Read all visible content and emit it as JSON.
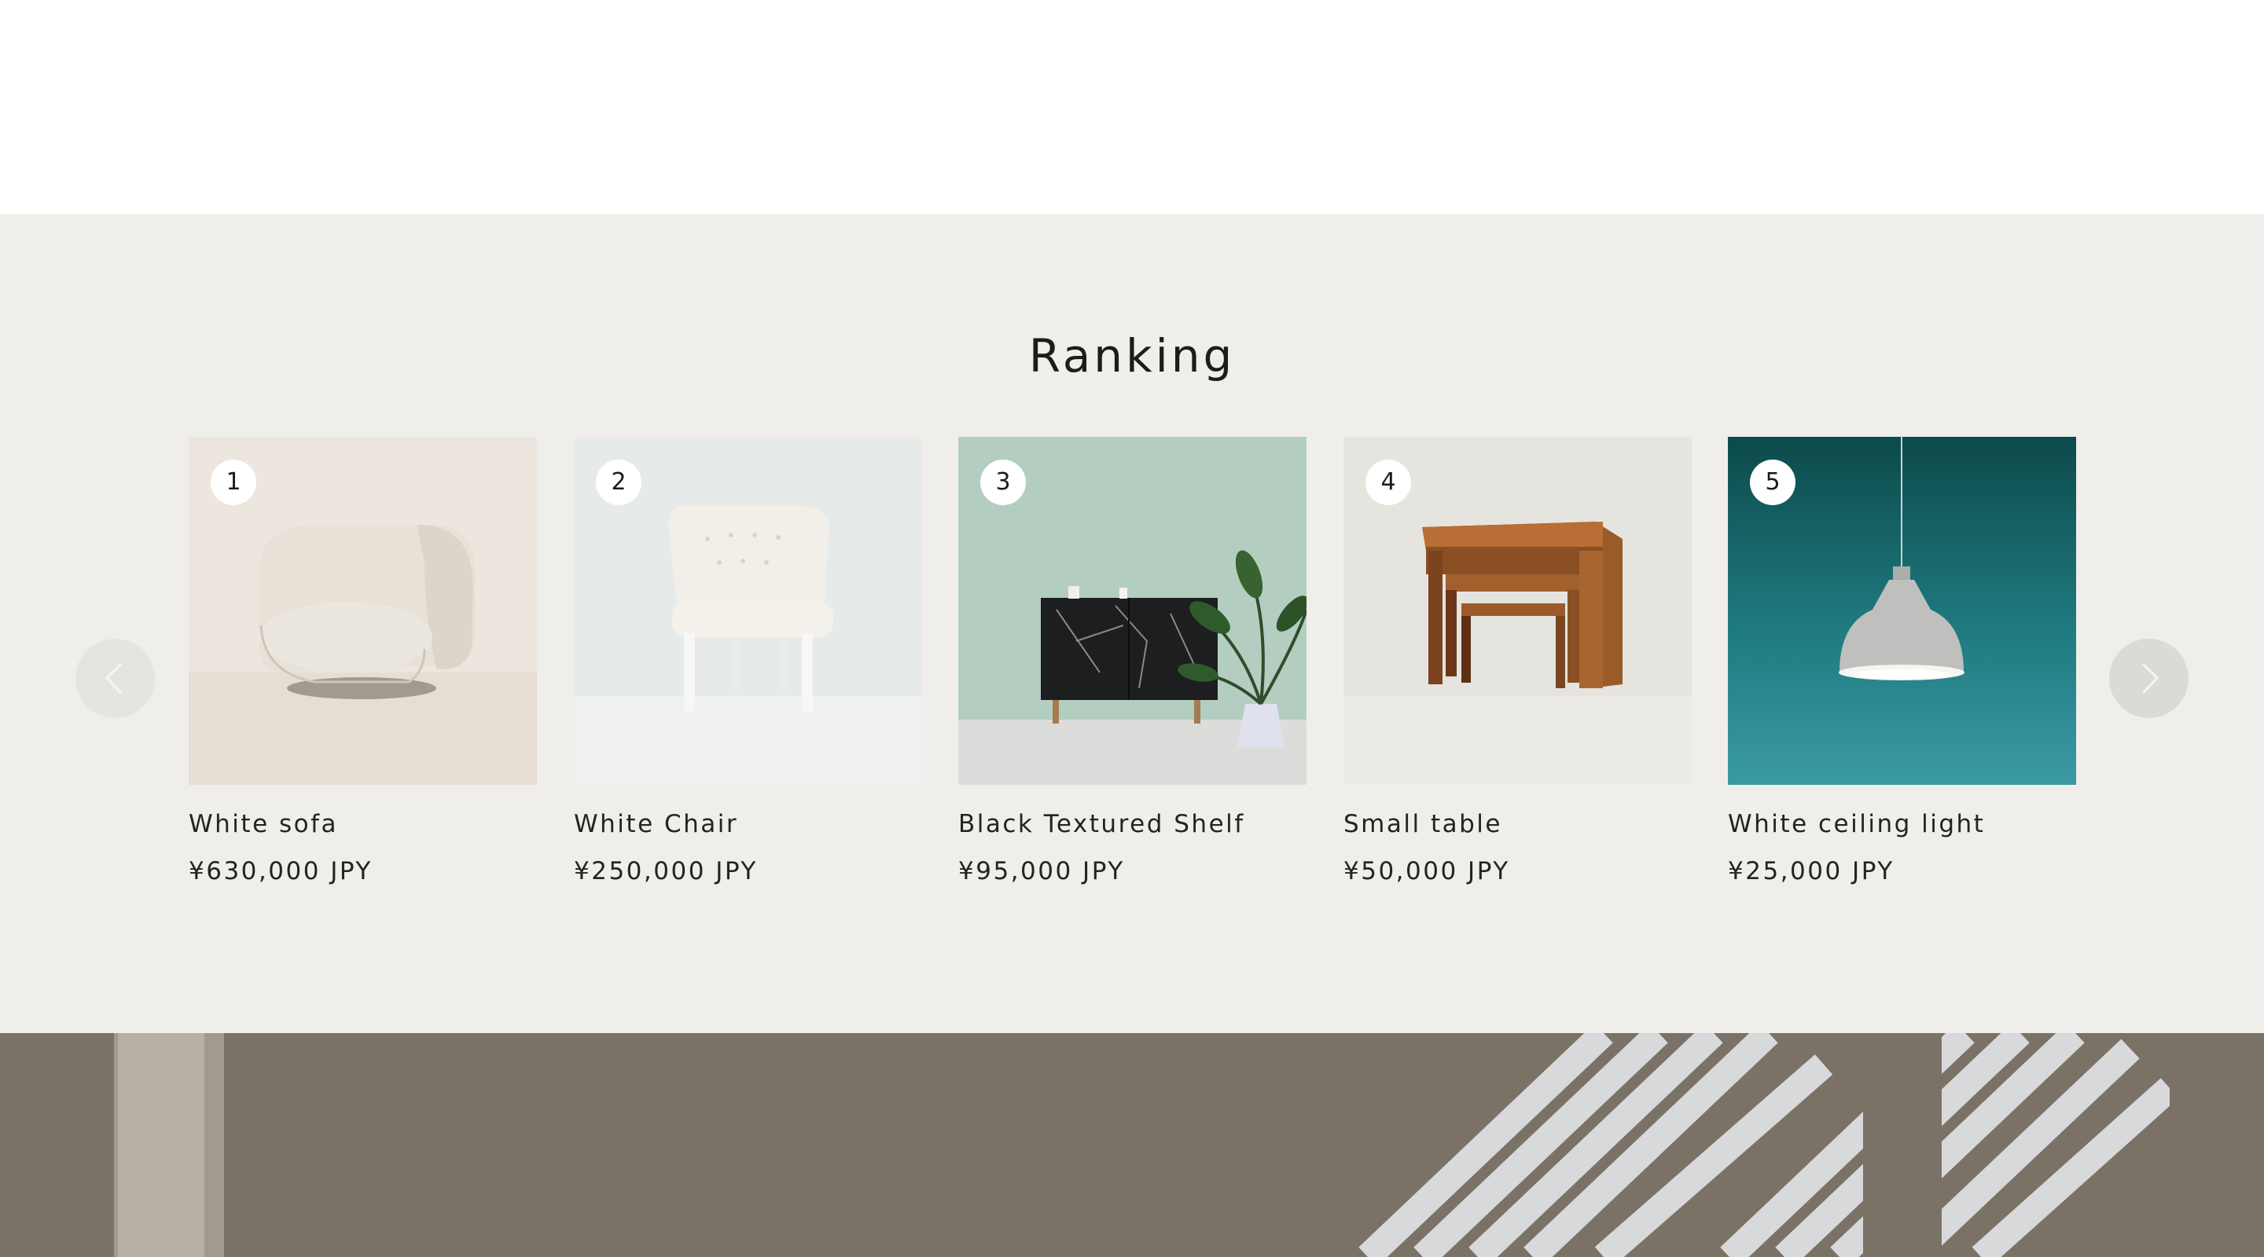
{
  "ranking": {
    "title": "Ranking",
    "prev_icon": "chevron-left-icon",
    "next_icon": "chevron-right-icon",
    "items": [
      {
        "rank": "1",
        "name": "White sofa",
        "price": "¥630,000 JPY"
      },
      {
        "rank": "2",
        "name": "White Chair",
        "price": "¥250,000 JPY"
      },
      {
        "rank": "3",
        "name": "Black Textured Shelf",
        "price": "¥95,000 JPY"
      },
      {
        "rank": "4",
        "name": "Small table",
        "price": "¥50,000 JPY"
      },
      {
        "rank": "5",
        "name": "White ceiling light",
        "price": "¥25,000 JPY"
      }
    ]
  },
  "colors": {
    "section_background": "#f0eeea",
    "text": "#1f1f1f",
    "badge": "#ffffff",
    "banner": "#7b7267"
  }
}
